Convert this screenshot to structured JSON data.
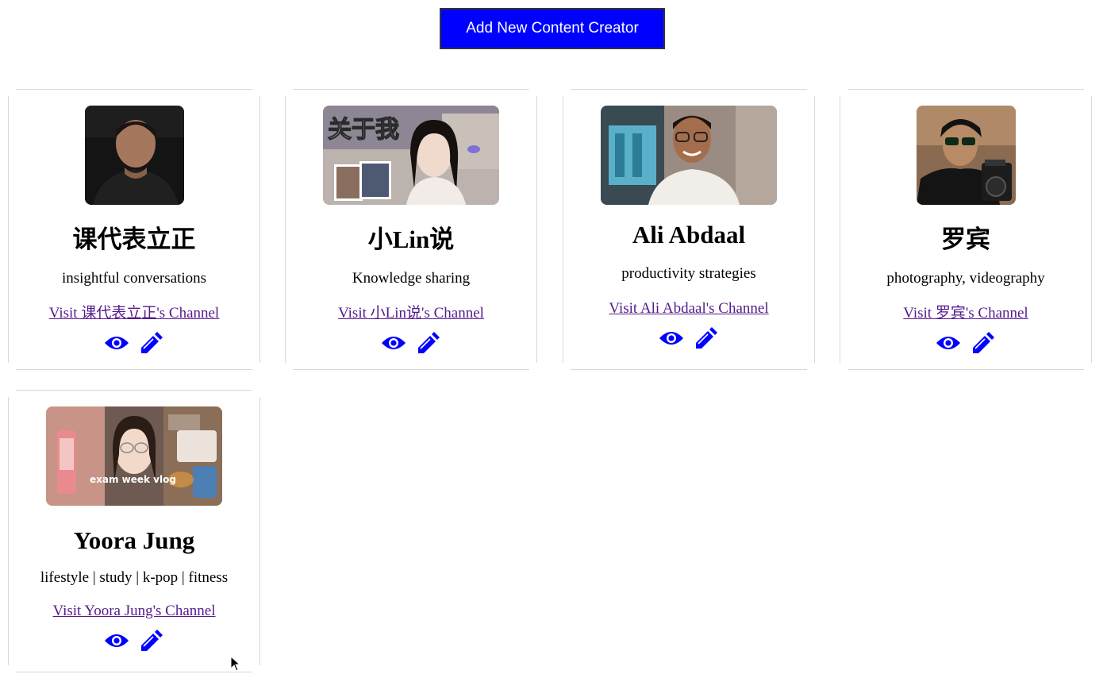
{
  "header": {
    "add_button_label": "Add New Content Creator"
  },
  "creators": [
    {
      "name": "课代表立正",
      "description": "insightful conversations",
      "link_label": "Visit 课代表立正's Channel",
      "view_icon": "eye-icon",
      "edit_icon": "pencil-icon"
    },
    {
      "name": "小Lin说",
      "description": "Knowledge sharing",
      "link_label": "Visit 小Lin说's Channel",
      "view_icon": "eye-icon",
      "edit_icon": "pencil-icon",
      "thumbnail_text": "关于我"
    },
    {
      "name": "Ali Abdaal",
      "description": "productivity strategies",
      "link_label": "Visit Ali Abdaal's Channel",
      "view_icon": "eye-icon",
      "edit_icon": "pencil-icon"
    },
    {
      "name": "罗宾",
      "description": "photography, videography",
      "link_label": "Visit 罗宾's Channel",
      "view_icon": "eye-icon",
      "edit_icon": "pencil-icon"
    },
    {
      "name": "Yoora Jung",
      "description": "lifestyle | study | k-pop | fitness",
      "link_label": "Visit Yoora Jung's Channel",
      "view_icon": "eye-icon",
      "edit_icon": "pencil-icon",
      "thumbnail_text": "exam week vlog"
    }
  ],
  "colors": {
    "accent": "#0000ff",
    "visited_link": "#551a8b",
    "card_border": "#d8d8d8"
  }
}
